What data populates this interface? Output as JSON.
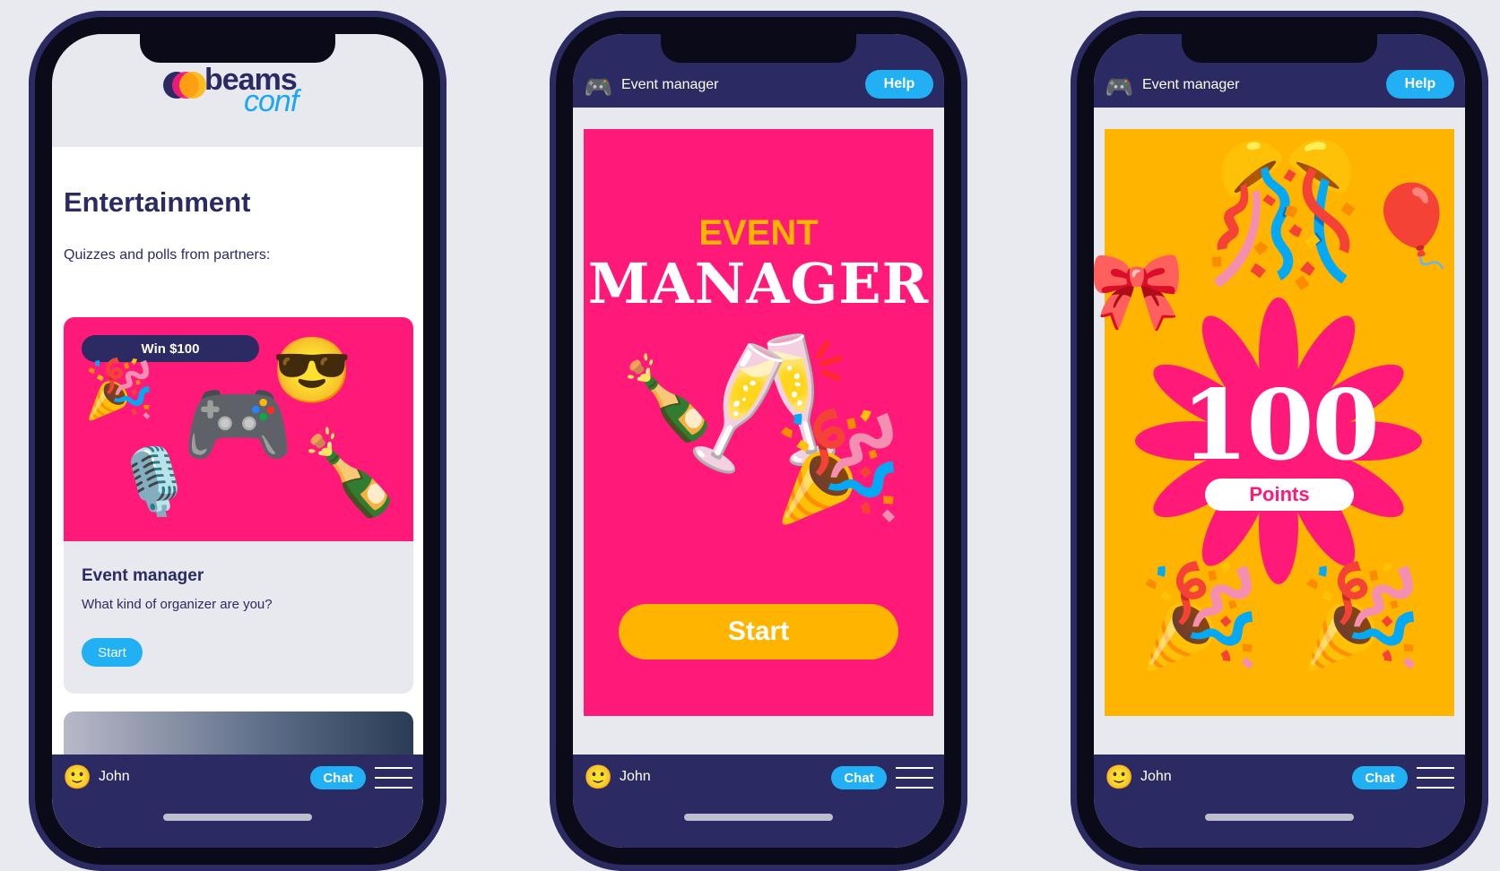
{
  "colors": {
    "navy": "#2b2a63",
    "pink": "#ff1a7a",
    "gold": "#ffb400",
    "blue": "#22b0f5",
    "background": "#e9e9f0"
  },
  "screen1": {
    "logo": {
      "line1": "beams",
      "line2": "conf"
    },
    "title": "Entertainment",
    "subtitle": "Quizzes and polls from partners:",
    "card": {
      "badge": "Win $100",
      "title": "Event manager",
      "description": "What kind of organizer are you?",
      "start_label": "Start",
      "emojis": [
        "party-popper-icon",
        "sunglasses-face-icon",
        "game-controller-icon",
        "microphone-icon",
        "champagne-bottle-icon"
      ]
    }
  },
  "screen2": {
    "header": {
      "title": "Event manager",
      "help_label": "Help",
      "icon": "game-controller-icon"
    },
    "event_word": "EVENT",
    "manager_word": "MANAGER",
    "start_label": "Start",
    "emojis": [
      "champagne-bottle-icon",
      "clinking-glasses-icon",
      "party-popper-icon"
    ]
  },
  "screen3": {
    "header": {
      "title": "Event manager",
      "help_label": "Help",
      "icon": "game-controller-icon"
    },
    "score": "100",
    "points_label": "Points",
    "emojis": [
      "bells-icon",
      "balloon-icon",
      "ribbon-bow-icon",
      "party-popper-icon",
      "party-popper-icon"
    ]
  },
  "bottom_bar": {
    "user_name": "John",
    "chat_label": "Chat",
    "user_icon": "smiley-face-icon",
    "menu_icon": "hamburger-menu-icon"
  }
}
